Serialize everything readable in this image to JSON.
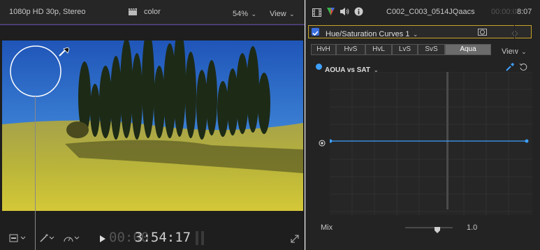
{
  "viewer": {
    "format_label": "1080p HD 30p, Stereo",
    "clip_name": "color",
    "zoom": "54%",
    "view_label": "View",
    "timecode_dim": "00:00",
    "timecode_main": "3:54:17"
  },
  "inspector": {
    "clip_title": "C002_C003_0514JQaacs",
    "duration_dim": "00:00:0",
    "duration_main": "8:07",
    "effect_name": "Hue/Saturation Curves 1",
    "effect_enabled": true,
    "tabs": [
      "HvH",
      "HvS",
      "HvL",
      "LvS",
      "SvS",
      "Aqua"
    ],
    "selected_tab": "Aqua",
    "view_label": "View",
    "curve_label": "AQUA vs SAT",
    "curve_color": "#3ea0ff",
    "mix_label": "Mix",
    "mix_value": "1.0"
  },
  "colors": {
    "accent_blue": "#3ea0ff",
    "header_outline": "#c9a227",
    "panel_bg": "#232323"
  }
}
